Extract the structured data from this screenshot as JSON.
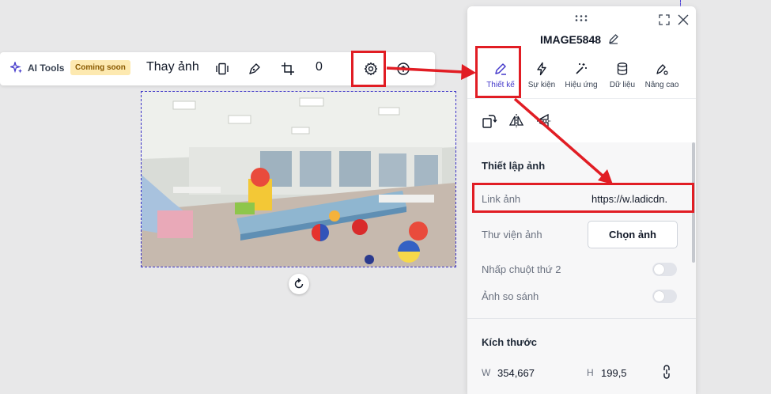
{
  "toolbar": {
    "ai_tools_label": "AI Tools",
    "coming_soon_badge": "Coming soon",
    "replace_image_label": "Thay ảnh",
    "number_value": "0",
    "icons": [
      "sparkle-icon",
      "frame-icon",
      "pen-icon",
      "crop-icon",
      "gear-icon",
      "info-icon"
    ]
  },
  "panel": {
    "title": "IMAGE5848",
    "tabs": [
      {
        "label": "Thiết kế",
        "icon": "edit-icon",
        "active": true
      },
      {
        "label": "Sự kiện",
        "icon": "lightning-icon",
        "active": false
      },
      {
        "label": "Hiệu ứng",
        "icon": "magic-wand-icon",
        "active": false
      },
      {
        "label": "Dữ liệu",
        "icon": "database-icon",
        "active": false
      },
      {
        "label": "Nâng cao",
        "icon": "pen-settings-icon",
        "active": false
      }
    ],
    "transform_icons": [
      "rotate-icon",
      "flip-horizontal-icon",
      "flip-vertical-icon"
    ],
    "image_settings": {
      "title": "Thiết lập ảnh",
      "link_label": "Link ảnh",
      "link_value": "https://w.ladicdn.",
      "library_label": "Thư viện ảnh",
      "choose_button": "Chọn ảnh",
      "right_click_label": "Nhấp chuột thứ 2",
      "compare_label": "Ảnh so sánh"
    },
    "size": {
      "title": "Kích thước",
      "w_label": "W",
      "w_value": "354,667",
      "h_label": "H",
      "h_value": "199,5"
    }
  },
  "colors": {
    "accent": "#4338ca",
    "highlight_red": "#e11d24",
    "badge_bg": "#fde9b0"
  }
}
